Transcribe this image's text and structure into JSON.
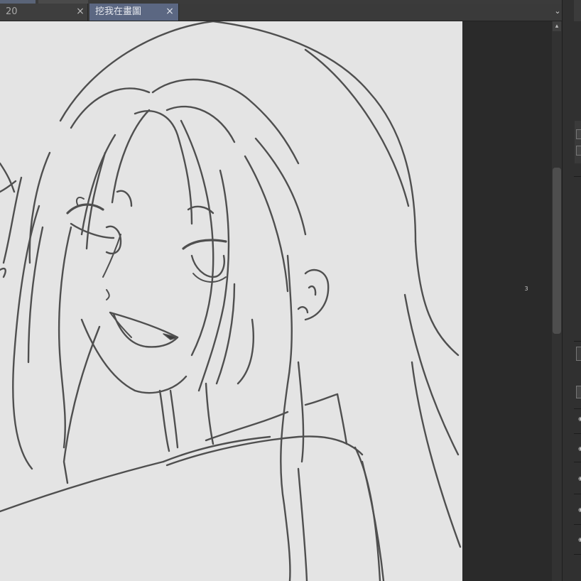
{
  "tabs": [
    {
      "label": "20",
      "active": false
    },
    {
      "label": "挖我在畫圖",
      "active": true
    }
  ],
  "icons": {
    "tab_close": "×",
    "tab_menu": "⌄",
    "scroll_up": "▴",
    "layer_eye": "◉"
  },
  "canvas": {
    "background": "#e4e4e4",
    "line_color": "#4f4f4f"
  },
  "pasteboard": {
    "page_number": "3"
  },
  "colors": {
    "active_tab": "#5b6782",
    "inactive_tab": "#3e3e3e",
    "workspace": "#2a2a2a"
  }
}
